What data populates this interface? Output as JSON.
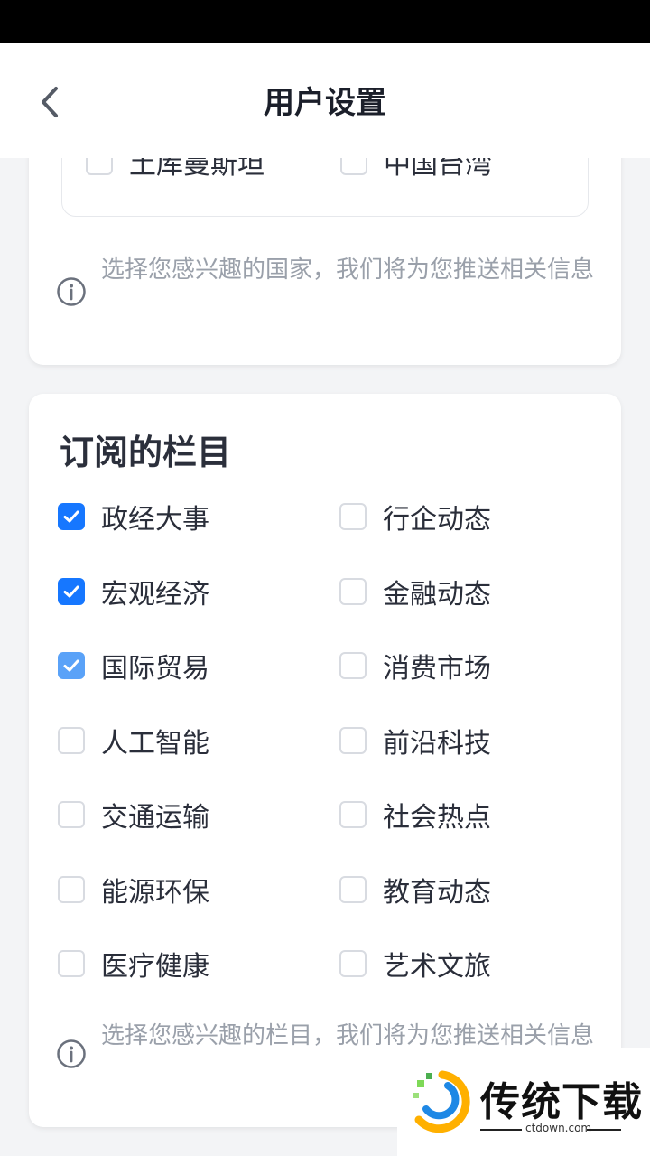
{
  "header": {
    "title": "用户设置"
  },
  "countries": {
    "options": [
      {
        "label": "土库曼斯坦",
        "checked": false
      },
      {
        "label": "中国台湾",
        "checked": false
      }
    ],
    "hint": "选择您感兴趣的国家，我们将为您推送相关信息"
  },
  "columns": {
    "title": "订阅的栏目",
    "options": [
      {
        "label": "政经大事",
        "checked": true
      },
      {
        "label": "行企动态",
        "checked": false
      },
      {
        "label": "宏观经济",
        "checked": true
      },
      {
        "label": "金融动态",
        "checked": false
      },
      {
        "label": "国际贸易",
        "checked": true
      },
      {
        "label": "消费市场",
        "checked": false
      },
      {
        "label": "人工智能",
        "checked": false
      },
      {
        "label": "前沿科技",
        "checked": false
      },
      {
        "label": "交通运输",
        "checked": false
      },
      {
        "label": "社会热点",
        "checked": false
      },
      {
        "label": "能源环保",
        "checked": false
      },
      {
        "label": "教育动态",
        "checked": false
      },
      {
        "label": "医疗健康",
        "checked": false
      },
      {
        "label": "艺术文旅",
        "checked": false
      }
    ],
    "hint": "选择您感兴趣的栏目，我们将为您推送相关信息"
  },
  "watermark": {
    "name": "传统下载",
    "domain": "ctdown.com"
  },
  "colors": {
    "accent": "#1677ff",
    "hint": "#9aa0aa"
  }
}
